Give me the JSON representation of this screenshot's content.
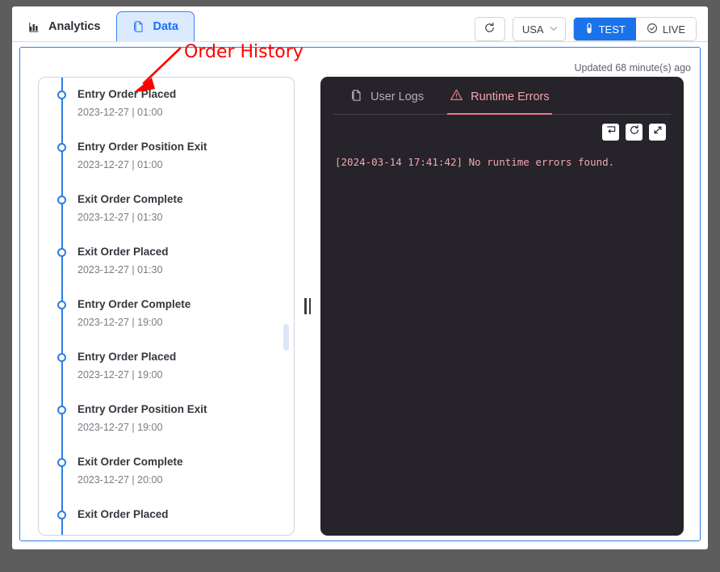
{
  "header": {
    "tabs": [
      {
        "label": "Analytics",
        "icon": "bar-chart-icon",
        "active": false
      },
      {
        "label": "Data",
        "icon": "document-icon",
        "active": true
      }
    ],
    "refresh_icon": "refresh-icon",
    "region": {
      "value": "USA",
      "chevron": "chevron-down-icon"
    },
    "modes": [
      {
        "label": "TEST",
        "icon": "test-tube-icon",
        "active": true
      },
      {
        "label": "LIVE",
        "icon": "circle-check-icon",
        "active": false
      }
    ]
  },
  "annotation": {
    "text": "Order History",
    "color": "#ff0000"
  },
  "content": {
    "updated_label": "Updated 68 minute(s) ago"
  },
  "timeline": {
    "items": [
      {
        "title": "Entry Order Placed",
        "subtitle": "2023-12-27 | 01:00"
      },
      {
        "title": "Entry Order Position Exit",
        "subtitle": "2023-12-27 | 01:00"
      },
      {
        "title": "Exit Order Complete",
        "subtitle": "2023-12-27 | 01:30"
      },
      {
        "title": "Exit Order Placed",
        "subtitle": "2023-12-27 | 01:30"
      },
      {
        "title": "Entry Order Complete",
        "subtitle": "2023-12-27 | 19:00"
      },
      {
        "title": "Entry Order Placed",
        "subtitle": "2023-12-27 | 19:00"
      },
      {
        "title": "Entry Order Position Exit",
        "subtitle": "2023-12-27 | 19:00"
      },
      {
        "title": "Exit Order Complete",
        "subtitle": "2023-12-27 | 20:00"
      },
      {
        "title": "Exit Order Placed",
        "subtitle": ""
      }
    ]
  },
  "console": {
    "tabs": [
      {
        "label": "User Logs",
        "icon": "document-icon",
        "active": false
      },
      {
        "label": "Runtime Errors",
        "icon": "warning-triangle-icon",
        "active": true
      }
    ],
    "toolbar": [
      {
        "icon": "wrap-text-icon"
      },
      {
        "icon": "refresh-icon"
      },
      {
        "icon": "expand-icon"
      }
    ],
    "output": "[2024-03-14 17:41:42] No runtime errors found."
  },
  "colors": {
    "accent_blue": "#1a73ea",
    "panel_border_blue": "#2f7de0",
    "console_bg": "#26232a",
    "error_pink": "#f0a8b2",
    "annotation_red": "#ff0000"
  }
}
